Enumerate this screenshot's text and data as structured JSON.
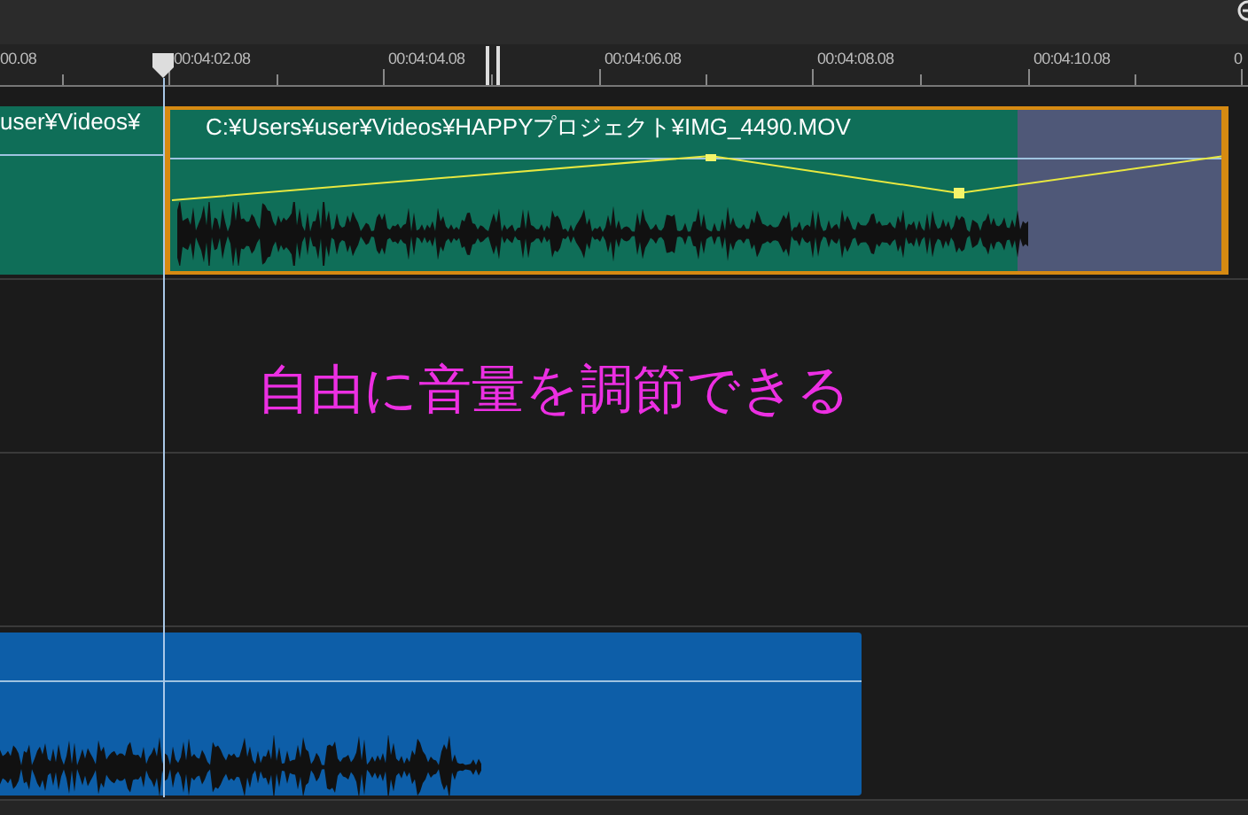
{
  "ruler": {
    "labels": [
      "00.08",
      "00:04:02.08",
      "00:04:04.08",
      "00:04:06.08",
      "00:04:08.08",
      "00:04:10.08",
      "0"
    ]
  },
  "video_track": {
    "clips": [
      {
        "kind": "media",
        "label": "user¥Videos¥",
        "selected": false
      },
      {
        "kind": "media",
        "label": "C:¥Users¥user¥Videos¥HAPPYプロジェクト¥IMG_4490.MOV",
        "selected": true
      }
    ]
  },
  "audio_track": {
    "clips": [
      {
        "kind": "audio"
      }
    ]
  },
  "annotation": "自由に音量を調節できる"
}
